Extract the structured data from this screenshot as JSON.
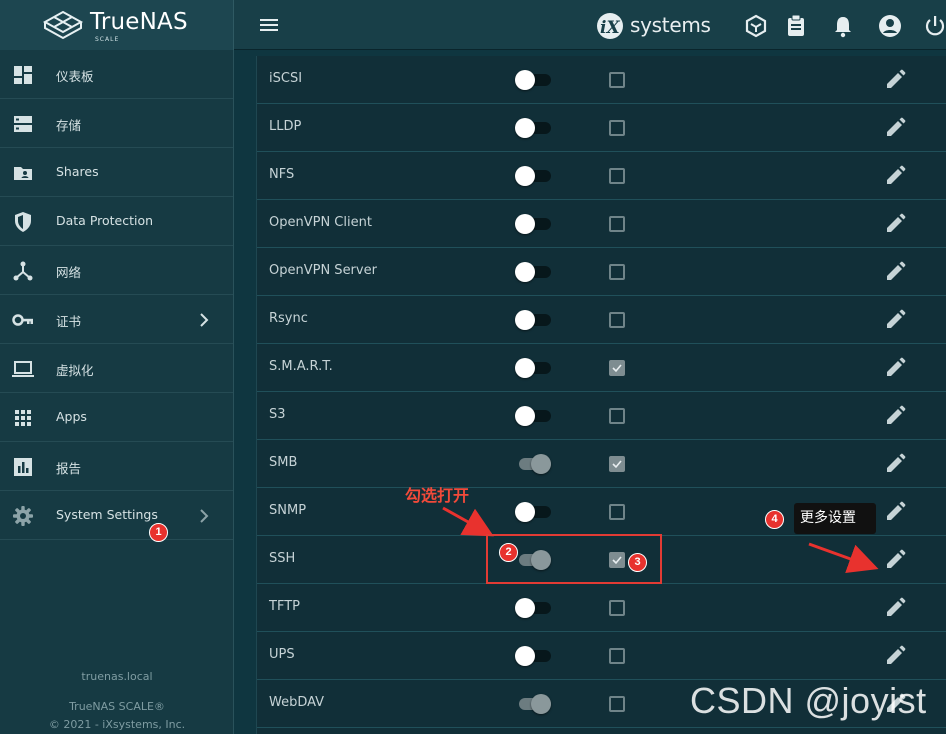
{
  "brand": {
    "name": "TrueNAS",
    "sub": "SCALE"
  },
  "vendor": {
    "name": "systems"
  },
  "sidebar": {
    "items": [
      {
        "label": "仪表板",
        "icon": "dashboard-icon"
      },
      {
        "label": "存储",
        "icon": "storage-icon"
      },
      {
        "label": "Shares",
        "icon": "folder-user-icon"
      },
      {
        "label": "Data Protection",
        "icon": "shield-icon"
      },
      {
        "label": "网络",
        "icon": "network-icon"
      },
      {
        "label": "证书",
        "icon": "key-icon"
      },
      {
        "label": "虚拟化",
        "icon": "laptop-icon"
      },
      {
        "label": "Apps",
        "icon": "apps-grid-icon"
      },
      {
        "label": "报告",
        "icon": "report-chart-icon"
      },
      {
        "label": "System Settings",
        "icon": "gear-icon"
      }
    ],
    "footer": {
      "hostname": "truenas.local",
      "product": "TrueNAS SCALE®",
      "copyright": "© 2021 - iXsystems, Inc."
    }
  },
  "services": [
    {
      "name": "iSCSI",
      "running": false,
      "autostart": false
    },
    {
      "name": "LLDP",
      "running": false,
      "autostart": false
    },
    {
      "name": "NFS",
      "running": false,
      "autostart": false
    },
    {
      "name": "OpenVPN Client",
      "running": false,
      "autostart": false
    },
    {
      "name": "OpenVPN Server",
      "running": false,
      "autostart": false
    },
    {
      "name": "Rsync",
      "running": false,
      "autostart": false
    },
    {
      "name": "S.M.A.R.T.",
      "running": false,
      "autostart": true
    },
    {
      "name": "S3",
      "running": false,
      "autostart": false
    },
    {
      "name": "SMB",
      "running": true,
      "autostart": true
    },
    {
      "name": "SNMP",
      "running": false,
      "autostart": false
    },
    {
      "name": "SSH",
      "running": true,
      "autostart": true
    },
    {
      "name": "TFTP",
      "running": false,
      "autostart": false
    },
    {
      "name": "UPS",
      "running": false,
      "autostart": false
    },
    {
      "name": "WebDAV",
      "running": true,
      "autostart": false
    }
  ],
  "annotations": {
    "check_open": "勾选打开",
    "more_settings": "更多设置",
    "badges": [
      "1",
      "2",
      "3",
      "4"
    ],
    "color": "#e8322e"
  },
  "watermark": "CSDN @joyist"
}
